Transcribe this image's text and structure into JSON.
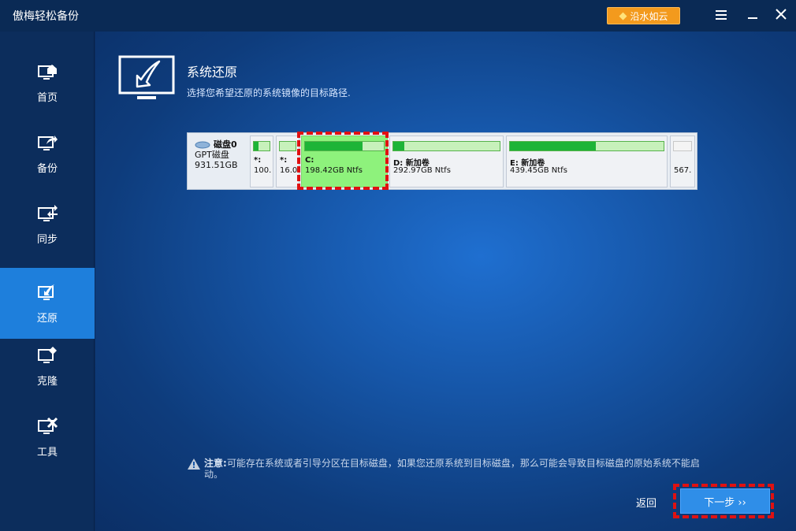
{
  "app": {
    "title": "傲梅轻松备份"
  },
  "titlebar": {
    "upgrade_label": "沿水如云",
    "icons": [
      "diamond-icon",
      "menu-icon",
      "minimize-icon",
      "close-icon"
    ]
  },
  "sidebar": {
    "items": [
      {
        "label": "首页",
        "icon": "home-monitor-icon"
      },
      {
        "label": "备份",
        "icon": "backup-monitor-icon"
      },
      {
        "label": "同步",
        "icon": "sync-monitor-icon"
      },
      {
        "label": "还原",
        "icon": "restore-monitor-icon",
        "active": true
      },
      {
        "label": "克隆",
        "icon": "clone-monitor-icon"
      },
      {
        "label": "工具",
        "icon": "tools-monitor-icon"
      }
    ]
  },
  "main": {
    "title": "系统还原",
    "subtitle": "选择您希望还原的系统镜像的目标路径.",
    "disk": {
      "name": "磁盘0",
      "type": "GPT磁盘",
      "size": "931.51GB",
      "partitions": [
        {
          "name": "*:",
          "size": "100.",
          "fill": 0.3
        },
        {
          "name": "*:",
          "size": "16.0",
          "fill": 0.0
        },
        {
          "name": "C:",
          "size": "198.42GB Ntfs",
          "fill": 0.73,
          "selected": true
        },
        {
          "name": "D: 新加卷",
          "size": "292.97GB Ntfs",
          "fill": 0.1
        },
        {
          "name": "E: 新加卷",
          "size": "439.45GB Ntfs",
          "fill": 0.56
        },
        {
          "name": "",
          "size": "567.",
          "fill": 0.0
        }
      ]
    },
    "warning": {
      "label": "注意:",
      "text": "可能存在系统或者引导分区在目标磁盘，如果您还原系统到目标磁盘，那么可能会导致目标磁盘的原始系统不能启动。"
    },
    "buttons": {
      "back": "返回",
      "next": "下一步 ››"
    }
  },
  "colors": {
    "sidebar_active": "#1e7fdc",
    "selected_partition": "#8ef27c",
    "usage_fill": "#1db437",
    "highlight_outline": "#e01111",
    "upgrade_button": "#f39a1d"
  }
}
